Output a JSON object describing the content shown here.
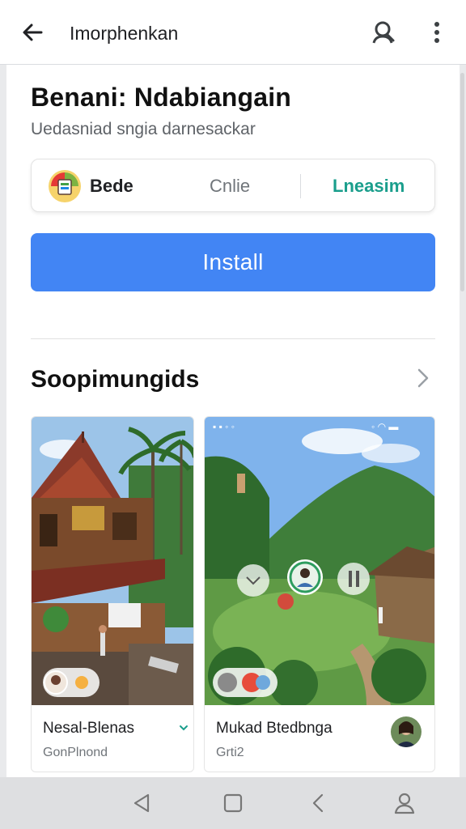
{
  "appbar": {
    "back_icon": "arrow-left-icon",
    "title": "Imorphenkan",
    "account_icon": "account-search-icon",
    "more_icon": "more-vert-icon"
  },
  "app": {
    "title": "Benani: Ndabiangain",
    "subtitle": "Uedasniad sngia darnesackar"
  },
  "info_card": {
    "developer": "Bede",
    "middle": "Cnlie",
    "right": "Lneasim",
    "right_color": "#1a9e8c"
  },
  "install": {
    "label": "Install",
    "color": "#4285f4"
  },
  "section": {
    "title": "Soopimungids",
    "arrow_icon": "chevron-right-icon"
  },
  "cards": [
    {
      "title": "Nesal-Blenas",
      "subtitle": "GonPlnond",
      "check_icon": "chevron-down-icon"
    },
    {
      "title": "Mukad Btedbnga",
      "subtitle": "Grti2",
      "avatar_icon": "avatar"
    }
  ],
  "navbar": {
    "items": [
      "back-triangle-icon",
      "home-square-icon",
      "recent-chevron-icon",
      "profile-icon"
    ]
  }
}
